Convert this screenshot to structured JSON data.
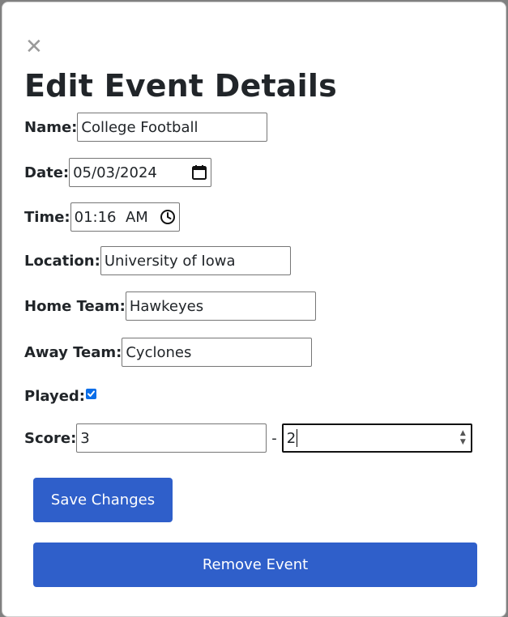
{
  "dialog": {
    "close_glyph": "✕",
    "title": "Edit Event Details"
  },
  "form": {
    "name": {
      "label": "Name:",
      "value": "College Football"
    },
    "date": {
      "label": "Date:",
      "value": "05/03/2024"
    },
    "time": {
      "label": "Time:",
      "value": "01:16  AM"
    },
    "location": {
      "label": "Location:",
      "value": "University of Iowa"
    },
    "home_team": {
      "label": "Home Team:",
      "value": "Hawkeyes"
    },
    "away_team": {
      "label": "Away Team:",
      "value": "Cyclones"
    },
    "played": {
      "label": "Played:",
      "checked": true
    },
    "score": {
      "label": "Score:",
      "home": "3",
      "separator": "-",
      "away": "2"
    }
  },
  "buttons": {
    "save": "Save Changes",
    "remove": "Remove Event"
  },
  "colors": {
    "button": "#2f5fca",
    "checkbox": "#0b6ee8"
  }
}
